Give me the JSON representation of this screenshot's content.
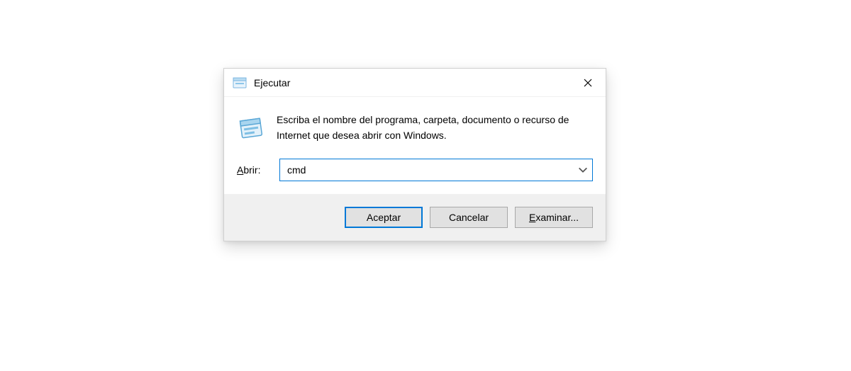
{
  "dialog": {
    "title": "Ejecutar",
    "description": "Escriba el nombre del programa, carpeta, documento o recurso de Internet que desea abrir con Windows.",
    "open_label_prefix": "A",
    "open_label_rest": "brir:",
    "input_value": "cmd",
    "buttons": {
      "ok": "Aceptar",
      "cancel": "Cancelar",
      "browse_prefix": "E",
      "browse_rest": "xaminar..."
    }
  }
}
